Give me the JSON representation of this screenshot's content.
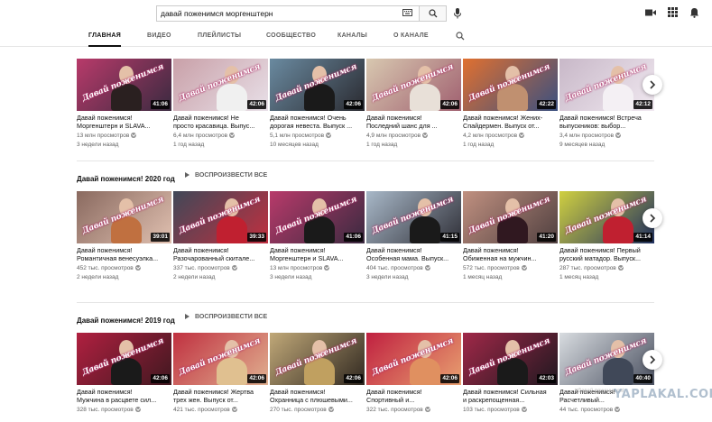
{
  "search": {
    "query": "давай поженимся моргенштерн"
  },
  "tabs": [
    "ГЛАВНАЯ",
    "ВИДЕО",
    "ПЛЕЙЛИСТЫ",
    "СООБЩЕСТВО",
    "КАНАЛЫ",
    "О КАНАЛЕ"
  ],
  "rows": [
    {
      "title": "",
      "play_all": "",
      "videos": [
        {
          "l1": "Давай поженимся!",
          "l2": "Моргенштерн и SLAVA...",
          "views": "13 млн просмотров",
          "age": "3 недели назад",
          "duration": "41:06"
        },
        {
          "l1": "Давай поженимся! Не",
          "l2": "просто красавица. Выпус...",
          "views": "6,4 млн просмотров",
          "age": "1 год назад",
          "duration": "42:06"
        },
        {
          "l1": "Давай поженимся! Очень",
          "l2": "дорогая невеста. Выпуск ...",
          "views": "5,1 млн просмотров",
          "age": "10 месяцев назад",
          "duration": "42:06"
        },
        {
          "l1": "Давай поженимся!",
          "l2": "Последний шанс для ...",
          "views": "4,9 млн просмотров",
          "age": "1 год назад",
          "duration": "42:06"
        },
        {
          "l1": "Давай поженимся! Жених-",
          "l2": "Спайдермен. Выпуск от...",
          "views": "4,2 млн просмотров",
          "age": "1 год назад",
          "duration": "42:22"
        },
        {
          "l1": "Давай поженимся! Встреча",
          "l2": "выпускников: выбор...",
          "views": "3,4 млн просмотров",
          "age": "9 месяцев назад",
          "duration": "42:12"
        }
      ]
    },
    {
      "title": "Давай поженимся! 2020 год",
      "play_all": "ВОСПРОИЗВЕСТИ ВСЕ",
      "videos": [
        {
          "l1": "Давай поженимся!",
          "l2": "Романтичная венесуэлка...",
          "views": "452 тыс. просмотров",
          "age": "2 недели назад",
          "duration": "39:01"
        },
        {
          "l1": "Давай поженимся!",
          "l2": "Разочарованный скитале...",
          "views": "337 тыс. просмотров",
          "age": "2 недели назад",
          "duration": "39:33"
        },
        {
          "l1": "Давай поженимся!",
          "l2": "Моргенштерн и SLAVA...",
          "views": "13 млн просмотров",
          "age": "3 недели назад",
          "duration": "41:06"
        },
        {
          "l1": "Давай поженимся!",
          "l2": "Особенная мама. Выпуск...",
          "views": "404 тыс. просмотров",
          "age": "3 недели назад",
          "duration": "41:15"
        },
        {
          "l1": "Давай поженимся!",
          "l2": "Обиженная на мужчин...",
          "views": "572 тыс. просмотров",
          "age": "1 месяц назад",
          "duration": "41:20"
        },
        {
          "l1": "Давай поженимся! Первый",
          "l2": "русский матадор. Выпуск...",
          "views": "287 тыс. просмотров",
          "age": "1 месяц назад",
          "duration": "41:14"
        }
      ]
    },
    {
      "title": "Давай поженимся! 2019 год",
      "play_all": "ВОСПРОИЗВЕСТИ ВСЕ",
      "videos": [
        {
          "l1": "Давай поженимся!",
          "l2": "Мужчина в расцвете сил...",
          "views": "328 тыс. просмотров",
          "age": "",
          "duration": "42:06"
        },
        {
          "l1": "Давай поженимся! Жертва",
          "l2": "трех жен. Выпуск от...",
          "views": "421 тыс. просмотров",
          "age": "",
          "duration": "42:06"
        },
        {
          "l1": "Давай поженимся!",
          "l2": "Охранница с плюшевыми...",
          "views": "270 тыс. просмотров",
          "age": "",
          "duration": "42:06"
        },
        {
          "l1": "Давай поженимся!",
          "l2": "Спортивный и...",
          "views": "322 тыс. просмотров",
          "age": "",
          "duration": "42:06"
        },
        {
          "l1": "Давай поженимся! Сильная",
          "l2": "и раскрепощенная...",
          "views": "103 тыс. просмотров",
          "age": "",
          "duration": "42:03"
        },
        {
          "l1": "Давай поженимся!",
          "l2": "Расчетливый...",
          "views": "44 тыс. просмотров",
          "age": "",
          "duration": "40:40"
        }
      ]
    }
  ],
  "thumb_logo": "Давай поженимся",
  "watermark": "YAPLAKAL.COM",
  "watermark_small": "Давай поженимся!"
}
